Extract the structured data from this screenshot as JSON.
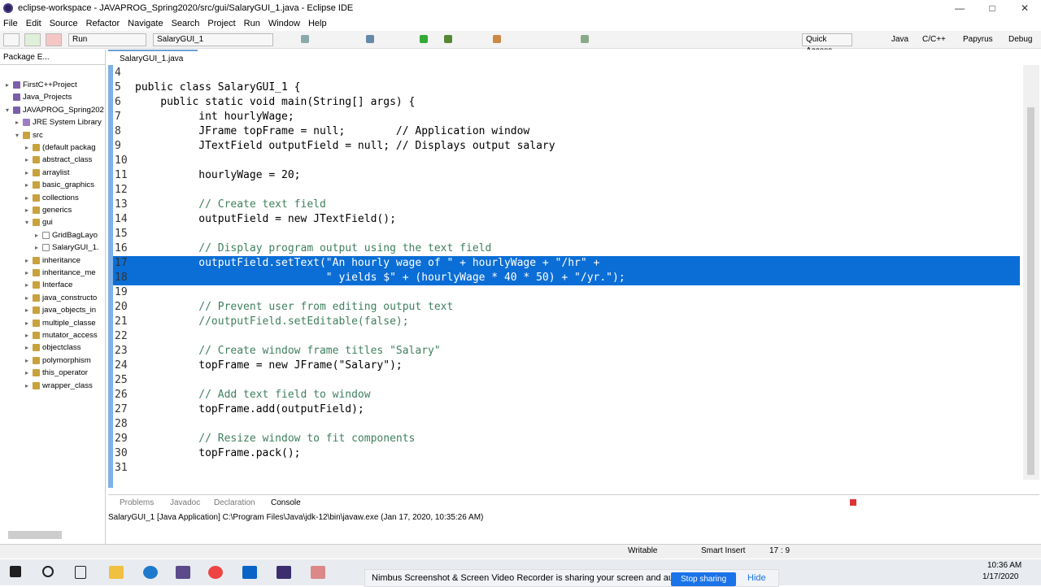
{
  "window": {
    "title": "eclipse-workspace - JAVAPROG_Spring2020/src/gui/SalaryGUI_1.java - Eclipse IDE"
  },
  "menu": [
    "File",
    "Edit",
    "Source",
    "Refactor",
    "Navigate",
    "Search",
    "Project",
    "Run",
    "Window",
    "Help"
  ],
  "toolbar": {
    "run_config": "Run",
    "file_combo": "SalaryGUI_1",
    "quick_access": "Quick Access",
    "perspectives": [
      "Java",
      "C/C++",
      "Papyrus",
      "Debug"
    ]
  },
  "left_panel": {
    "tab": "Package E...",
    "tree": [
      {
        "label": "FirstC++Project",
        "type": "proj",
        "indent": 0,
        "arrow": "▸"
      },
      {
        "label": "Java_Projects",
        "type": "proj",
        "indent": 0,
        "arrow": ""
      },
      {
        "label": "JAVAPROG_Spring202",
        "type": "proj",
        "indent": 0,
        "arrow": "▾"
      },
      {
        "label": "JRE System Library",
        "type": "jre",
        "indent": 1,
        "arrow": "▸"
      },
      {
        "label": "src",
        "type": "pkg",
        "indent": 1,
        "arrow": "▾"
      },
      {
        "label": "(default packag",
        "type": "pkg",
        "indent": 2,
        "arrow": "▸"
      },
      {
        "label": "abstract_class",
        "type": "pkg",
        "indent": 2,
        "arrow": "▸"
      },
      {
        "label": "arraylist",
        "type": "pkg",
        "indent": 2,
        "arrow": "▸"
      },
      {
        "label": "basic_graphics",
        "type": "pkg",
        "indent": 2,
        "arrow": "▸"
      },
      {
        "label": "collections",
        "type": "pkg",
        "indent": 2,
        "arrow": "▸"
      },
      {
        "label": "generics",
        "type": "pkg",
        "indent": 2,
        "arrow": "▸"
      },
      {
        "label": "gui",
        "type": "pkg",
        "indent": 2,
        "arrow": "▾"
      },
      {
        "label": "GridBagLayo",
        "type": "jfile",
        "indent": 3,
        "arrow": "▸"
      },
      {
        "label": "SalaryGUI_1.",
        "type": "jfile",
        "indent": 3,
        "arrow": "▸"
      },
      {
        "label": "inheritance",
        "type": "pkg",
        "indent": 2,
        "arrow": "▸"
      },
      {
        "label": "inheritance_me",
        "type": "pkg",
        "indent": 2,
        "arrow": "▸"
      },
      {
        "label": "Interface",
        "type": "pkg",
        "indent": 2,
        "arrow": "▸"
      },
      {
        "label": "java_constructo",
        "type": "pkg",
        "indent": 2,
        "arrow": "▸"
      },
      {
        "label": "java_objects_in",
        "type": "pkg",
        "indent": 2,
        "arrow": "▸"
      },
      {
        "label": "multiple_classe",
        "type": "pkg",
        "indent": 2,
        "arrow": "▸"
      },
      {
        "label": "mutator_access",
        "type": "pkg",
        "indent": 2,
        "arrow": "▸"
      },
      {
        "label": "objectclass",
        "type": "pkg",
        "indent": 2,
        "arrow": "▸"
      },
      {
        "label": "polymorphism",
        "type": "pkg",
        "indent": 2,
        "arrow": "▸"
      },
      {
        "label": "this_operator",
        "type": "pkg",
        "indent": 2,
        "arrow": "▸"
      },
      {
        "label": "wrapper_class",
        "type": "pkg",
        "indent": 2,
        "arrow": "▸"
      }
    ]
  },
  "editor": {
    "tab": "SalaryGUI_1.java",
    "lines": [
      {
        "n": "4",
        "t": ""
      },
      {
        "n": "5",
        "t": "public class SalaryGUI_1 {"
      },
      {
        "n": "6",
        "t": "    public static void main(String[] args) {"
      },
      {
        "n": "7",
        "t": "          int hourlyWage;"
      },
      {
        "n": "8",
        "t": "          JFrame topFrame = null;        // Application window"
      },
      {
        "n": "9",
        "t": "          JTextField outputField = null; // Displays output salary"
      },
      {
        "n": "10",
        "t": ""
      },
      {
        "n": "11",
        "t": "          hourlyWage = 20;"
      },
      {
        "n": "12",
        "t": ""
      },
      {
        "n": "13",
        "t": "          // Create text field"
      },
      {
        "n": "14",
        "t": "          outputField = new JTextField();"
      },
      {
        "n": "15",
        "t": ""
      },
      {
        "n": "16",
        "t": "          // Display program output using the text field"
      },
      {
        "n": "17",
        "t": "          outputField.setText(\"An hourly wage of \" + hourlyWage + \"/hr\" +"
      },
      {
        "n": "18",
        "t": "                              \" yields $\" + (hourlyWage * 40 * 50) + \"/yr.\");"
      },
      {
        "n": "19",
        "t": ""
      },
      {
        "n": "20",
        "t": "          // Prevent user from editing output text"
      },
      {
        "n": "21",
        "t": "          //outputField.setEditable(false);"
      },
      {
        "n": "22",
        "t": ""
      },
      {
        "n": "23",
        "t": "          // Create window frame titles \"Salary\""
      },
      {
        "n": "24",
        "t": "          topFrame = new JFrame(\"Salary\");"
      },
      {
        "n": "25",
        "t": ""
      },
      {
        "n": "26",
        "t": "          // Add text field to window"
      },
      {
        "n": "27",
        "t": "          topFrame.add(outputField);"
      },
      {
        "n": "28",
        "t": ""
      },
      {
        "n": "29",
        "t": "          // Resize window to fit components"
      },
      {
        "n": "30",
        "t": "          topFrame.pack();"
      },
      {
        "n": "31",
        "t": ""
      }
    ]
  },
  "console": {
    "tabs": [
      "Problems",
      "Javadoc",
      "Declaration",
      "Console"
    ],
    "text": "SalaryGUI_1 [Java Application] C:\\Program Files\\Java\\jdk-12\\bin\\javaw.exe (Jan 17, 2020, 10:35:26 AM)"
  },
  "status": {
    "writable": "Writable",
    "insert": "Smart Insert",
    "pos": "17 : 9"
  },
  "taskbar": {
    "time": "10:36 AM",
    "date": "1/17/2020"
  },
  "notification": {
    "text": "Nimbus Screenshot & Screen Video Recorder is sharing your screen and audio.",
    "stop": "Stop sharing",
    "hide": "Hide"
  }
}
